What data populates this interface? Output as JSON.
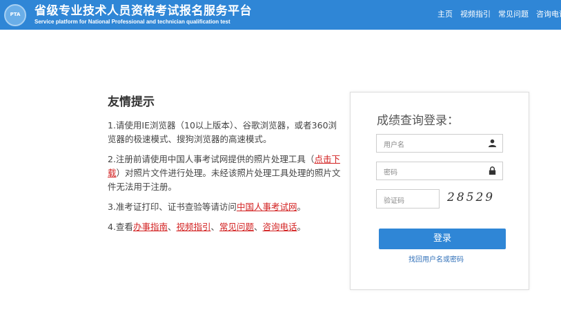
{
  "header": {
    "logo_text": "PTA",
    "title_cn": "省级专业技术人员资格考试报名服务平台",
    "title_en": "Service platform for National Professional and technician qualification test",
    "nav": [
      "主页",
      "视频指引",
      "常见问题",
      "咨询电话"
    ]
  },
  "tips": {
    "heading": "友情提示",
    "item1": "1.请使用IE浏览器（10以上版本）、谷歌浏览器，或者360浏览器的极速模式、搜狗浏览器的高速模式。",
    "item2_a": "2.注册前请使用中国人事考试网提供的照片处理工具（",
    "item2_link": "点击下载",
    "item2_b": "）对照片文件进行处理。未经该照片处理工具处理的照片文件无法用于注册。",
    "item3_a": "3.准考证打印、证书查验等请访问",
    "item3_link": "中国人事考试网",
    "item3_b": "。",
    "item4_a": "4.查看",
    "item4_link1": "办事指南",
    "sep": "、",
    "item4_link2": "视频指引",
    "item4_link3": "常见问题",
    "item4_link4": "咨询电话",
    "item4_end": "。"
  },
  "login": {
    "title": "成绩查询登录：",
    "username_placeholder": "用户名",
    "password_placeholder": "密码",
    "captcha_placeholder": "验证码",
    "captcha_text": "28529",
    "login_button": "登录",
    "forgot_link": "找回用户名或密码"
  },
  "colors": {
    "header_bg": "#2f86d6",
    "link_red": "#d21f1f",
    "button_blue": "#2f86d6"
  }
}
